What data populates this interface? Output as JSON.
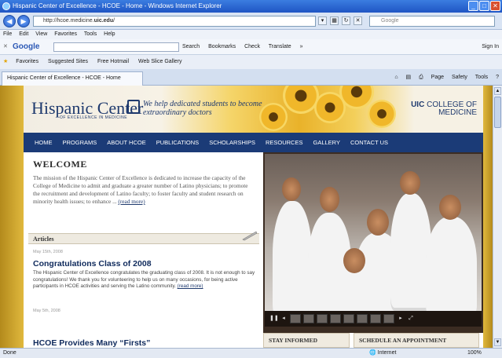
{
  "window": {
    "title": "Hispanic Center of Excellence - HCOE - Home - Windows Internet Explorer"
  },
  "address": {
    "prefix": "http://hcoe.medicine.",
    "bold": "uic.edu",
    "suffix": "/"
  },
  "search_placeholder": "Google",
  "menu": [
    "File",
    "Edit",
    "View",
    "Favorites",
    "Tools",
    "Help"
  ],
  "google_toolbar": {
    "logo": "Google",
    "items": [
      "Search",
      "Bookmarks",
      "Check",
      "Translate",
      "»"
    ],
    "signin": "Sign In"
  },
  "favorites_bar": {
    "favorites": "Favorites",
    "items": [
      "Suggested Sites",
      "Free Hotmail",
      "Web Slice Gallery"
    ]
  },
  "tab": {
    "label": "Hispanic Center of Excellence - HCOE - Home"
  },
  "command_bar": [
    "Page",
    "Safety",
    "Tools"
  ],
  "site": {
    "logo_main": "Hispanic Center",
    "logo_sub": "OF EXCELLENCE IN MEDICINE",
    "tagline": "We help dedicated students to become extraordinary doctors",
    "uic_bold": "UIC",
    "uic_line1": "COLLEGE OF",
    "uic_line2": "MEDICINE",
    "nav": [
      "HOME",
      "PROGRAMS",
      "ABOUT HCOE",
      "PUBLICATIONS",
      "SCHOLARSHIPS",
      "RESOURCES",
      "GALLERY",
      "CONTACT US"
    ],
    "welcome_title": "WELCOME",
    "welcome_text": "The mission of the Hispanic Center of Excellence is dedicated to increase the capacity of the College of Medicine to admit and graduate a greater number of Latino physicians; to promote the recruitment and development of Latino faculty; to foster faculty and student research on minority health issues; to enhance ...",
    "welcome_more": "(read more)",
    "articles_header": "Articles",
    "article1_date": "May 15th, 2008",
    "article1_title": "Congratulations Class of 2008",
    "article1_body": "The Hispanic Center of Excellence congratulates the graduating class of 2008. It is not enough to say congratulations! We thank you for volunteering to help us on many occasions, for being active participants in HCOE activities and serving the Latino community.",
    "article1_more": "(read more)",
    "article2_date": "May 5th, 2008",
    "article2_title": "HCOE Provides Many “Firsts”",
    "stay_informed": "STAY INFORMED",
    "schedule": "SCHEDULE AN APPOINTMENT"
  },
  "status": {
    "left": "Done",
    "zone": "Internet",
    "zoom": "100%"
  }
}
